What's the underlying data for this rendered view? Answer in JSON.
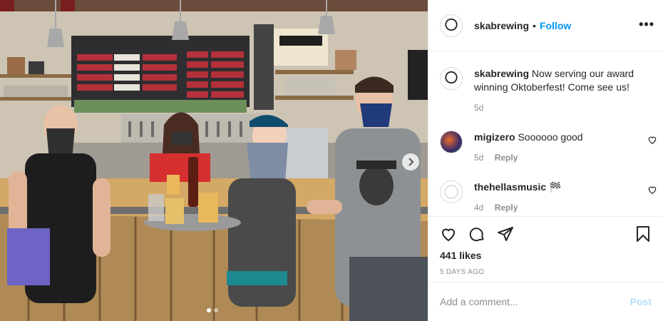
{
  "post": {
    "username": "skabrewing",
    "follow_label": "Follow",
    "separator": "•",
    "more_label": "•••",
    "caption": "Now serving our award winning Oktoberfest! Come see us!",
    "caption_age": "5d"
  },
  "comments": [
    {
      "username": "migizero",
      "text": "Soooooo good",
      "age": "5d",
      "reply_label": "Reply"
    },
    {
      "username": "thehellasmusic",
      "text": "🏁",
      "age": "4d",
      "reply_label": "Reply"
    }
  ],
  "stats": {
    "likes": "441 likes",
    "date": "5 DAYS AGO"
  },
  "comment_box": {
    "placeholder": "Add a comment...",
    "post_label": "Post"
  },
  "photo": {
    "carousel_count": 2,
    "current_index": 0,
    "colors": {
      "wall": "#cfc6b8",
      "bar": "#c69a5a",
      "menu": "#3b3b3b"
    }
  },
  "icons": [
    "heart-icon",
    "comment-icon",
    "share-icon",
    "bookmark-icon",
    "chevron-right-icon",
    "more-icon"
  ]
}
